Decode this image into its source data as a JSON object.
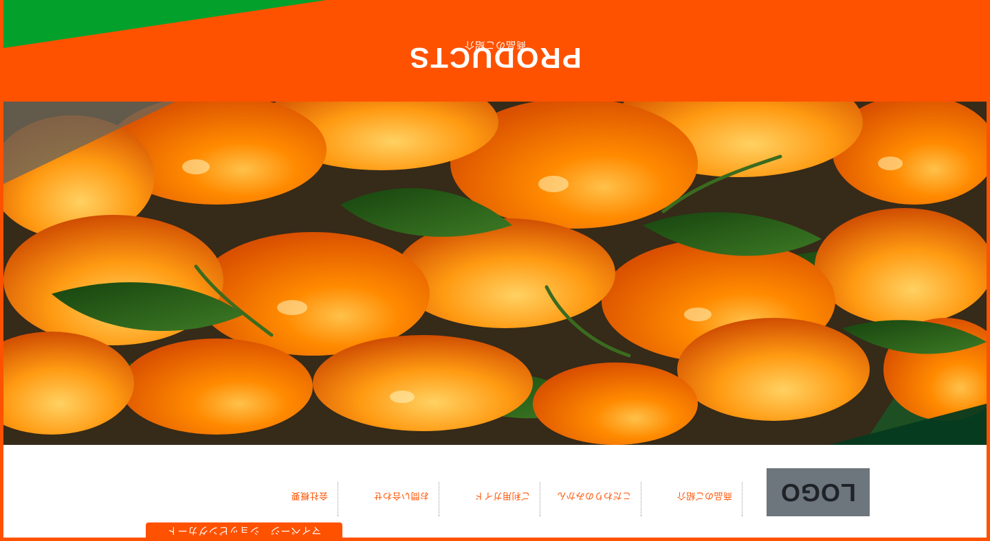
{
  "top_tab": {
    "label": "マイページ　ショッピングカート"
  },
  "header": {
    "logo_text": "LOGO",
    "nav": [
      {
        "label": "商品のご紹介"
      },
      {
        "label": "こだわりのみかん"
      },
      {
        "label": "ご利用ガイド"
      },
      {
        "label": "お問い合わせ"
      },
      {
        "label": "会社概要"
      }
    ]
  },
  "hero": {
    "image": "mandarin-oranges-with-leaves"
  },
  "page_header": {
    "title": "PRODUCTS",
    "subtitle": "商品のご紹介"
  },
  "colors": {
    "brand": "#ff5200",
    "accent_green": "#03a02c",
    "logo_bg": "#6d757d",
    "white": "#ffffff"
  }
}
